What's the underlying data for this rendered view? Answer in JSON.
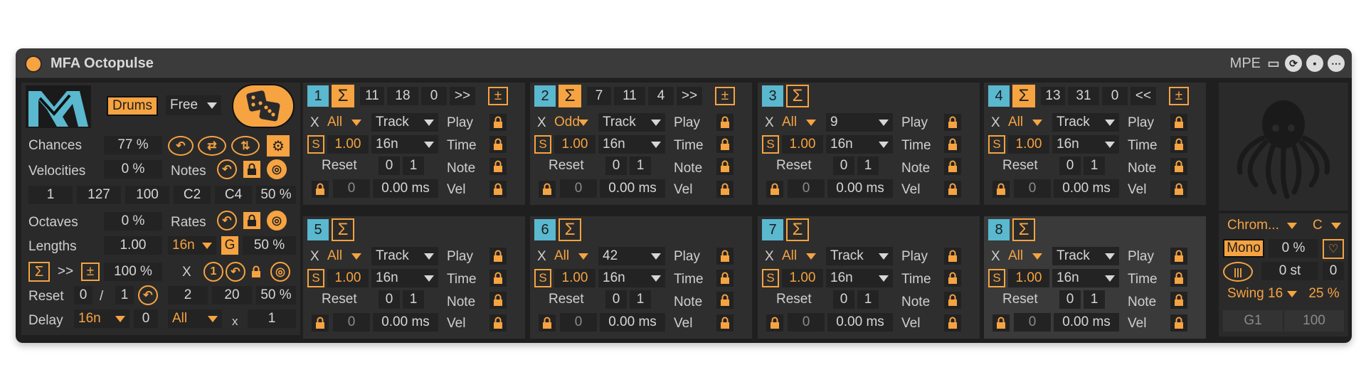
{
  "title": "MFA Octopulse",
  "titlebar": {
    "mpe": "MPE"
  },
  "left": {
    "mode_btn": "Drums",
    "timing_dd": "Free",
    "chances_label": "Chances",
    "chances_val": "77 %",
    "velocities_label": "Velocities",
    "velocities_val": "0 %",
    "notes_label": "Notes",
    "vel_min": "1",
    "vel_max": "127",
    "vel_def": "100",
    "note_low": "C2",
    "note_high": "C4",
    "note_pct": "50 %",
    "octaves_label": "Octaves",
    "octaves_val": "0 %",
    "rates_label": "Rates",
    "lengths_label": "Lengths",
    "lengths_val": "1.00",
    "rate_dd": "16n",
    "rate_g": "G",
    "rate_pct": "50 %",
    "dir": ">>",
    "pm": "±",
    "sum_pct": "100 %",
    "x": "X",
    "one": "1",
    "reset_label": "Reset",
    "reset_a": "0",
    "slash": "/",
    "reset_b": "1",
    "r2": "2",
    "r20": "20",
    "r_pct": "50 %",
    "delay_label": "Delay",
    "delay_dd": "16n",
    "delay_val": "0",
    "delay_all": "All",
    "delay_x": "x",
    "delay_n": "1"
  },
  "tracks": [
    {
      "n": "1",
      "hdr": [
        "11",
        "18",
        "0",
        ">>"
      ],
      "x": "All",
      "src": "Track",
      "s": "1.00",
      "rate": "16n",
      "ra": "0",
      "rb": "1",
      "lk": "0",
      "ms": "0.00 ms",
      "sum_on": true
    },
    {
      "n": "2",
      "hdr": [
        "7",
        "11",
        "4",
        ">>"
      ],
      "x": "Odd",
      "src": "Track",
      "s": "1.00",
      "rate": "16n",
      "ra": "0",
      "rb": "1",
      "lk": "0",
      "ms": "0.00 ms",
      "sum_on": true
    },
    {
      "n": "3",
      "hdr": [],
      "x": "All",
      "src": "9",
      "s": "1.00",
      "rate": "16n",
      "ra": "0",
      "rb": "1",
      "lk": "0",
      "ms": "0.00 ms",
      "sum_on": false
    },
    {
      "n": "4",
      "hdr": [
        "13",
        "31",
        "0",
        "<<"
      ],
      "x": "All",
      "src": "Track",
      "s": "1.00",
      "rate": "16n",
      "ra": "0",
      "rb": "1",
      "lk": "0",
      "ms": "0.00 ms",
      "sum_on": true
    },
    {
      "n": "5",
      "hdr": [],
      "x": "All",
      "src": "Track",
      "s": "1.00",
      "rate": "16n",
      "ra": "0",
      "rb": "1",
      "lk": "0",
      "ms": "0.00 ms",
      "sum_on": false
    },
    {
      "n": "6",
      "hdr": [],
      "x": "All",
      "src": "42",
      "s": "1.00",
      "rate": "16n",
      "ra": "0",
      "rb": "1",
      "lk": "0",
      "ms": "0.00 ms",
      "sum_on": false
    },
    {
      "n": "7",
      "hdr": [],
      "x": "All",
      "src": "Track",
      "s": "1.00",
      "rate": "16n",
      "ra": "0",
      "rb": "1",
      "lk": "0",
      "ms": "0.00 ms",
      "sum_on": false
    },
    {
      "n": "8",
      "hdr": [],
      "x": "All",
      "src": "Track",
      "s": "1.00",
      "rate": "16n",
      "ra": "0",
      "rb": "1",
      "lk": "0",
      "ms": "0.00 ms",
      "sum_on": false
    }
  ],
  "track_labels": {
    "x": "X",
    "s": "S",
    "reset": "Reset",
    "play": "Play",
    "time": "Time",
    "note": "Note",
    "vel": "Vel",
    "pm": "±"
  },
  "right": {
    "scale_dd": "Chrom...",
    "key_dd": "C",
    "mono": "Mono",
    "mono_pct": "0 %",
    "st": "0 st",
    "st_val": "0",
    "swing_dd": "Swing 16",
    "swing_pct": "25 %",
    "out_note": "G1",
    "out_vel": "100"
  }
}
